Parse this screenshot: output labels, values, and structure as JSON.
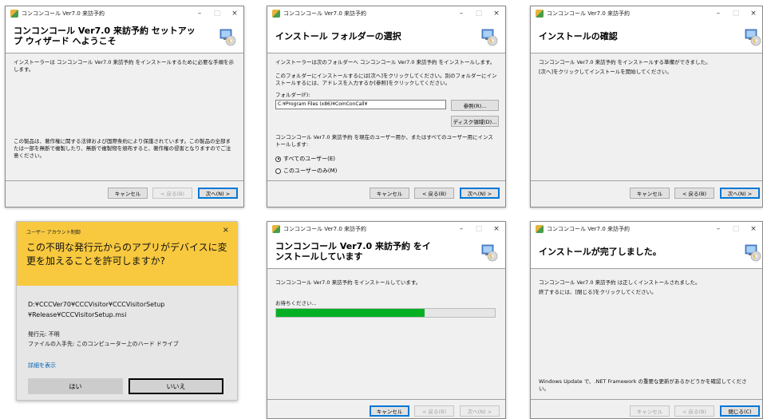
{
  "colors": {
    "accent": "#0078d7",
    "uac_header": "#f8c93f",
    "progress": "#06b025",
    "link": "#0063b1"
  },
  "app_title": "コンコンコール Ver7.0 来訪予約",
  "window_controls": {
    "minimize": "–",
    "maximize": "□",
    "close": "×"
  },
  "buttons": {
    "cancel": "キャンセル",
    "back": "< 戻る(B)",
    "next": "次へ(N) >",
    "close": "閉じる(C)"
  },
  "welcome": {
    "header": "コンコンコール Ver7.0 来訪予約 セットアップ ウィザード へようこそ",
    "body": "インストーラーは コンコンコール Ver7.0 来訪予約 をインストールするために必要な手順を示します。",
    "warning": "この製品は、著作権に関する法律および国際条約により保護されています。この製品の全部または一部を無断で複製したり、無断で複製物を頒布すると、著作権の侵害となりますのでご注意ください。"
  },
  "folder": {
    "header": "インストール フォルダーの選択",
    "body1": "インストーラーは次のフォルダーへ コンコンコール Ver7.0 来訪予約 をインストールします。",
    "body2": "このフォルダーにインストールするには[次へ]をクリックしてください。別のフォルダーにインストールするには、アドレスを入力するか[参照]をクリックしてください。",
    "folder_label": "フォルダー(F):",
    "folder_value": "C:¥Program Files (x86)¥ComConCall¥",
    "browse": "参照(R)...",
    "disk_cost": "ディスク領域(D)...",
    "users_text": "コンコンコール Ver7.0 来訪予約 を現在のユーザー用か、またはすべてのユーザー用にインストールします:",
    "radio_all": "すべてのユーザー(E)",
    "radio_me": "このユーザーのみ(M)"
  },
  "confirm": {
    "header": "インストールの確認",
    "body1": "コンコンコール Ver7.0 来訪予約 をインストールする準備ができました。",
    "body2": "[次へ]をクリックしてインストールを開始してください。"
  },
  "uac": {
    "label": "ユーザー アカウント制御",
    "question": "この不明な発行元からのアプリがデバイスに変更を加えることを許可しますか?",
    "path_line1": "D:¥CCCVer70¥CCCVisitor¥CCCVisitorSetup",
    "path_line2": "¥Release¥CCCVisitorSetup.msi",
    "publisher": "発行元: 不明",
    "origin": "ファイルの入手先: このコンピューター上のハード ドライブ",
    "details": "詳細を表示",
    "yes": "はい",
    "no": "いいえ"
  },
  "installing": {
    "header": "コンコンコール Ver7.0 来訪予約 をインストールしています",
    "body": "コンコンコール Ver7.0 来訪予約 をインストールしています。",
    "wait": "お待ちください...",
    "progress": 0.68
  },
  "complete": {
    "header": "インストールが完了しました。",
    "body1": "コンコンコール Ver7.0 来訪予約 は正しくインストールされました。",
    "body2": "終了するには、[閉じる]をクリックしてください。",
    "update_note": "Windows Update で、.NET Framework の重要な更新があるかどうかを確認してください。"
  }
}
